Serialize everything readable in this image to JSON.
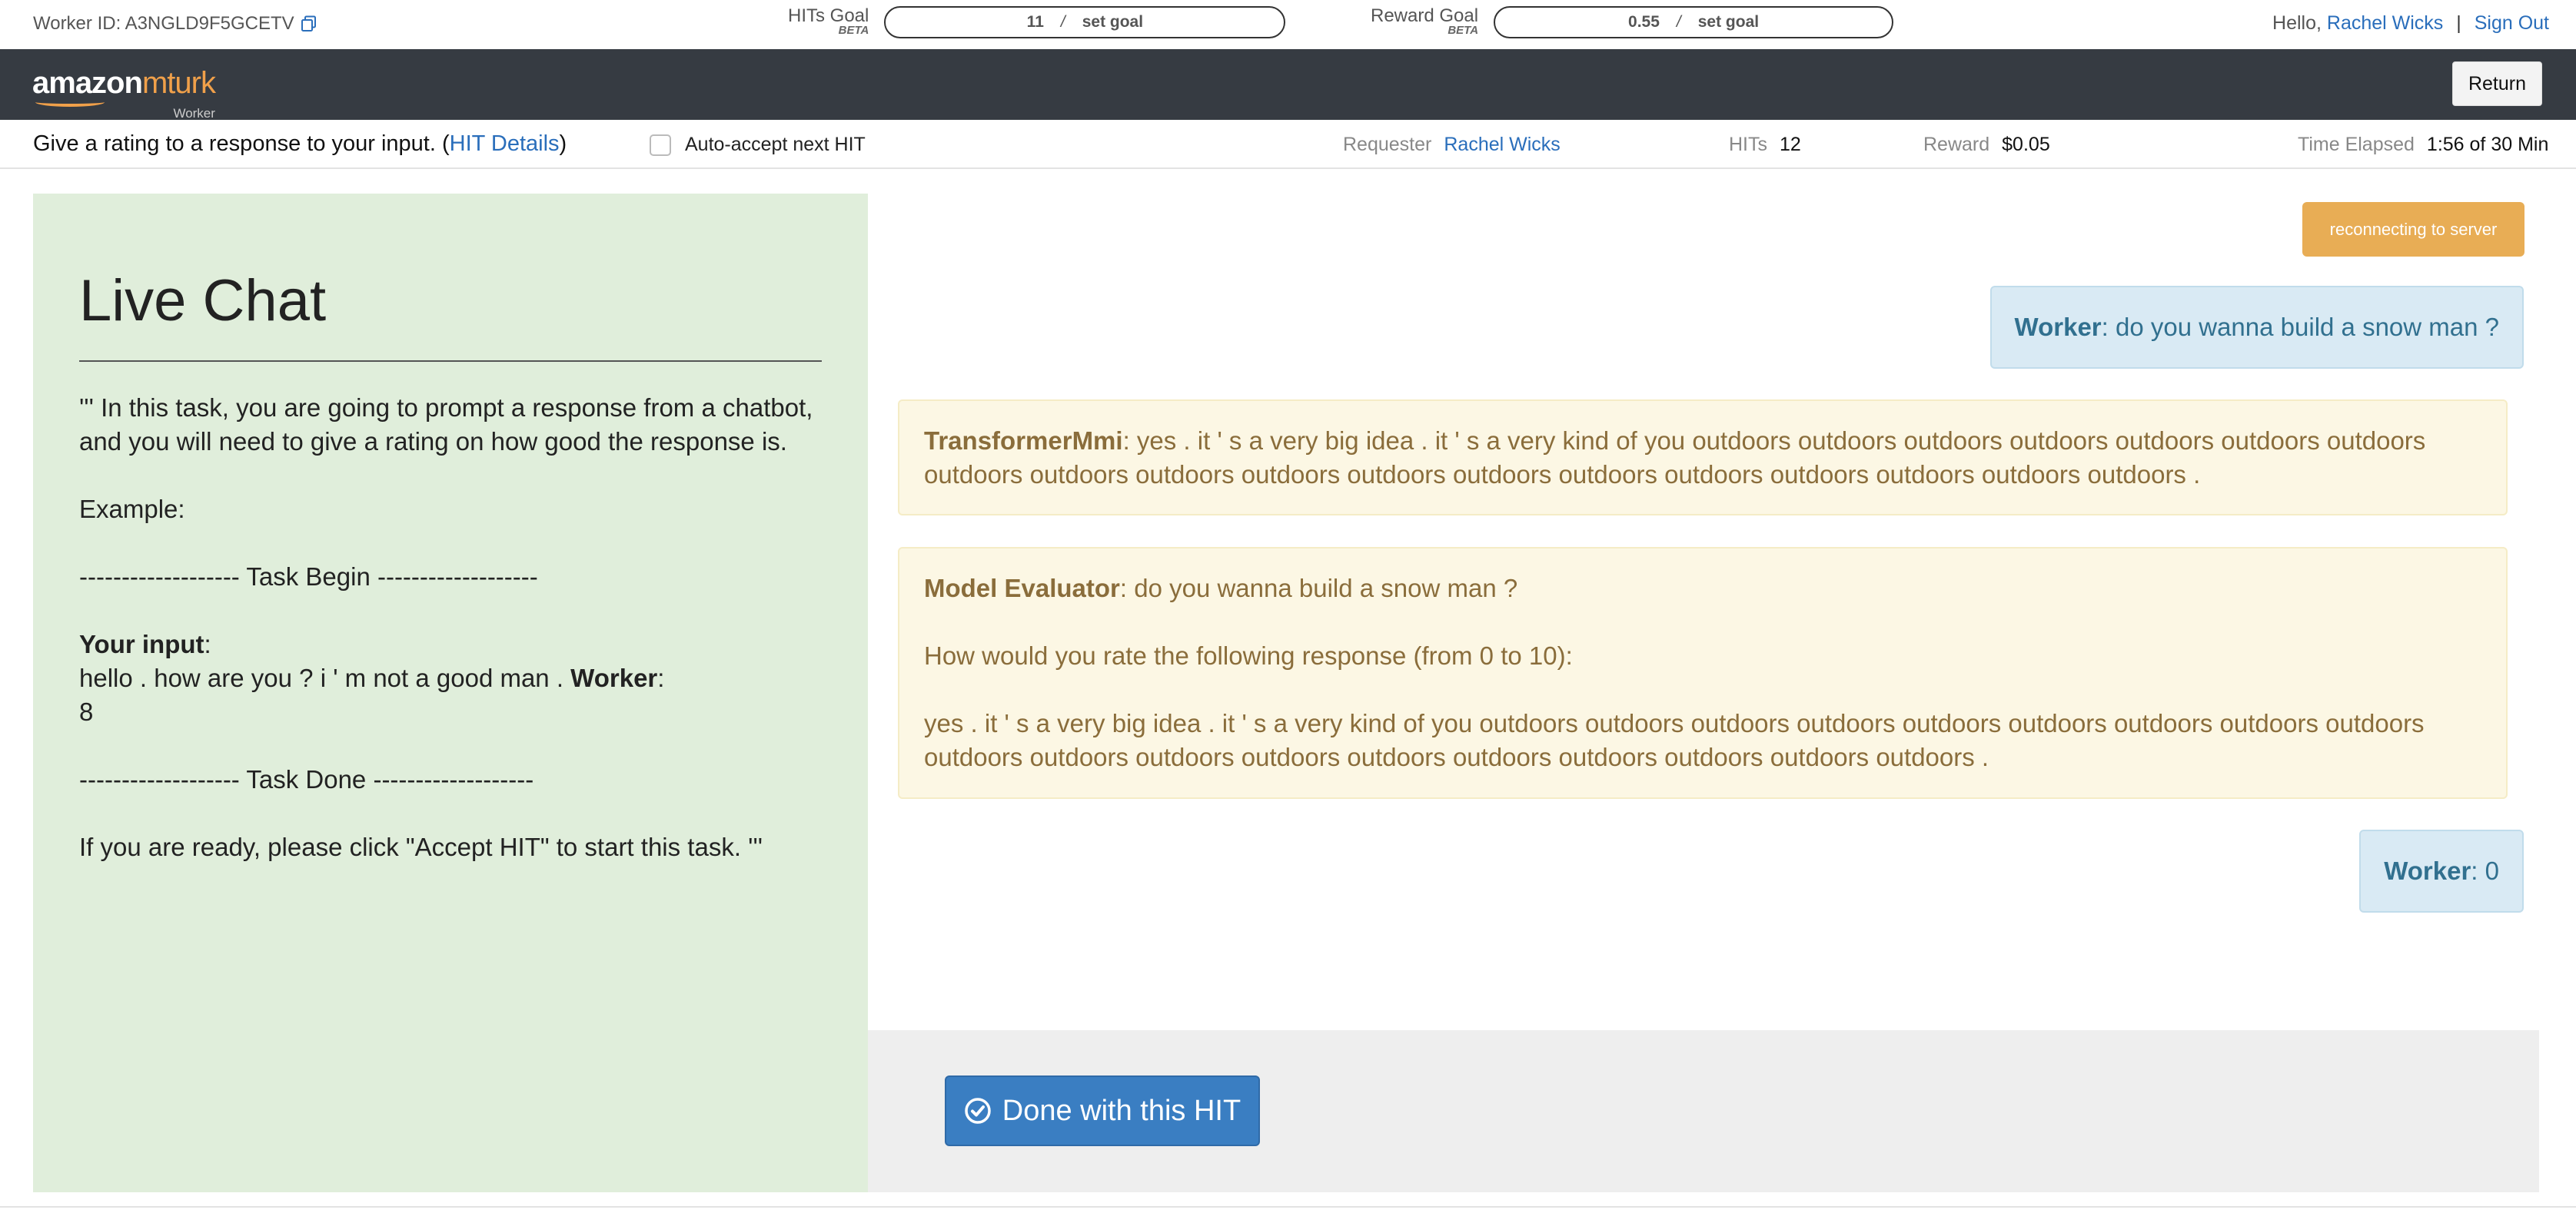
{
  "topbar": {
    "worker_id": "Worker ID: A3NGLD9F5GCETV",
    "hits_goal": {
      "label": "HITs Goal",
      "beta": "BETA",
      "value": "11",
      "slash": "/",
      "set_goal": "set goal"
    },
    "reward_goal": {
      "label": "Reward Goal",
      "beta": "BETA",
      "value": "0.55",
      "slash": "/",
      "set_goal": "set goal"
    },
    "hello": "Hello,",
    "user_name": "Rachel Wicks",
    "separator": "|",
    "sign_out": "Sign Out"
  },
  "navbar": {
    "logo_amazon": "amazon",
    "logo_mturk": "mturk",
    "logo_worker": "Worker",
    "return_label": "Return"
  },
  "infobar": {
    "task_title": "Give a rating to a response to your input. (",
    "hit_details": "HIT Details",
    "task_title_close": ")",
    "auto_accept": "Auto-accept next HIT",
    "requester_label": "Requester",
    "requester_value": "Rachel Wicks",
    "hits_label": "HITs",
    "hits_value": "12",
    "reward_label": "Reward",
    "reward_value": "$0.05",
    "time_label": "Time Elapsed",
    "time_value": "1:56 of 30 Min"
  },
  "left_panel": {
    "title": "Live Chat",
    "intro": "''' In this task, you are going to prompt a response from a chatbot, and you will need to give a rating on how good the response is.",
    "example": "Example:",
    "task_begin": "------------------- Task Begin -------------------",
    "your_input_label": "Your input",
    "your_input_colon": ":",
    "example_input": "hello . how are you ? i ' m not a good man . ",
    "worker_label": "Worker",
    "worker_colon": ":",
    "example_rating": "8",
    "task_done": "------------------- Task Done -------------------",
    "closing": "If you are ready, please click \"Accept HIT\" to start this task. '''"
  },
  "chat": {
    "status": "reconnecting to server",
    "messages": [
      {
        "speaker": "Worker",
        "text": ": do you wanna build a snow man ?"
      },
      {
        "speaker": "TransformerMmi",
        "text": ": yes . it ' s a very big idea . it ' s a very kind of you outdoors outdoors outdoors outdoors outdoors outdoors outdoors outdoors outdoors outdoors outdoors outdoors outdoors outdoors outdoors outdoors outdoors outdoors outdoors ."
      },
      {
        "speaker": "Model Evaluator",
        "text": ": do you wanna build a snow man ?",
        "question": "How would you rate the following response (from 0 to 10):",
        "response": "yes . it ' s a very big idea . it ' s a very kind of you outdoors outdoors outdoors outdoors outdoors outdoors outdoors outdoors outdoors outdoors outdoors outdoors outdoors outdoors outdoors outdoors outdoors outdoors outdoors ."
      },
      {
        "speaker": "Worker",
        "text": ": 0"
      }
    ]
  },
  "footer": {
    "done_label": "Done with this HIT"
  },
  "colors": {
    "nav_dark": "#363b42",
    "link_blue": "#2a6ebb",
    "mturk_orange": "#f0a04a",
    "left_panel_green": "#e0eedb",
    "worker_bubble": "#d9eaf4",
    "bot_bubble": "#fcf7e4",
    "status_orange": "#e8ad55",
    "done_button": "#3a7ec2"
  },
  "icons": [
    "copy-icon",
    "check-circle-icon"
  ]
}
